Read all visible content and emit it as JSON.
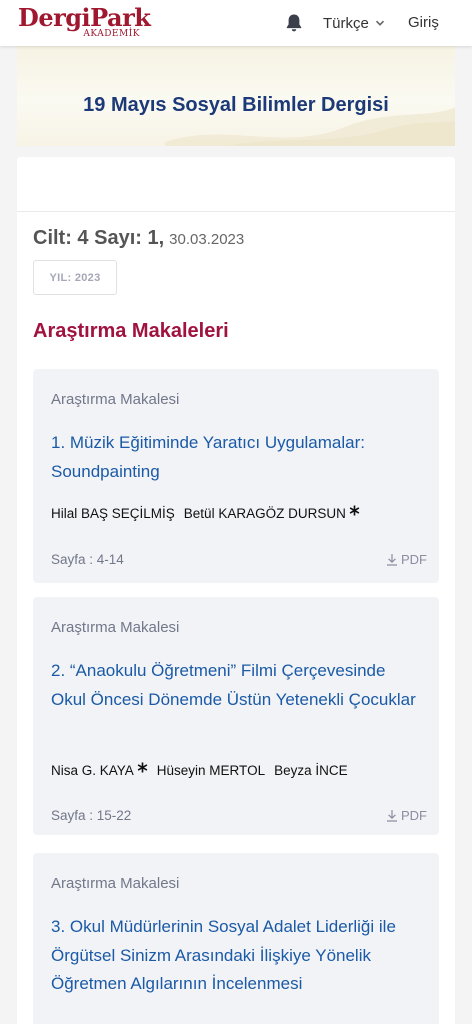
{
  "nav": {
    "logo_main": "DergiPark",
    "logo_sub": "AKADEMİK",
    "language": "Türkçe",
    "login": "Giriş"
  },
  "journal": {
    "title": "19 Mayıs Sosyal Bilimler Dergisi"
  },
  "issue": {
    "label": "Cilt: 4 Sayı: 1,",
    "date": "30.03.2023",
    "year_badge": "YIL: 2023"
  },
  "section": {
    "title": "Araştırma Makaleleri"
  },
  "articles": [
    {
      "type": "Araştırma Makalesi",
      "title": "1. Müzik Eğitiminde Yaratıcı Uygulamalar: Soundpainting",
      "authors": [
        "Hilal BAŞ SEÇİLMİŞ",
        "Betül KARAGÖZ DURSUN"
      ],
      "pages": "Sayfa : 4-14",
      "pdf_label": "PDF"
    },
    {
      "type": "Araştırma Makalesi",
      "title": "2. “Anaokulu Öğretmeni” Filmi Çerçevesinde Okul Öncesi Dönemde Üstün Yetenekli Çocuklar",
      "authors": [
        "Nisa G. KAYA",
        "Hüseyin MERTOL",
        "Beyza İNCE"
      ],
      "pages": "Sayfa : 15-22",
      "pdf_label": "PDF"
    },
    {
      "type": "Araştırma Makalesi",
      "title": "3. Okul Müdürlerinin Sosyal Adalet Liderliği ile Örgütsel Sinizm Arasındaki İlişkiye Yönelik Öğretmen Algılarının İncelenmesi"
    }
  ],
  "colors": {
    "brand": "#a0182f",
    "journal_title": "#1d3a78",
    "section_title": "#a0123f",
    "article_link": "#1a5aa6",
    "card_bg": "#f2f3f7"
  },
  "icons": {
    "bell": "bell-icon",
    "language_toggle": "chevron-down-icon",
    "corresponding_author": "asterisk-icon",
    "download": "download-icon"
  }
}
